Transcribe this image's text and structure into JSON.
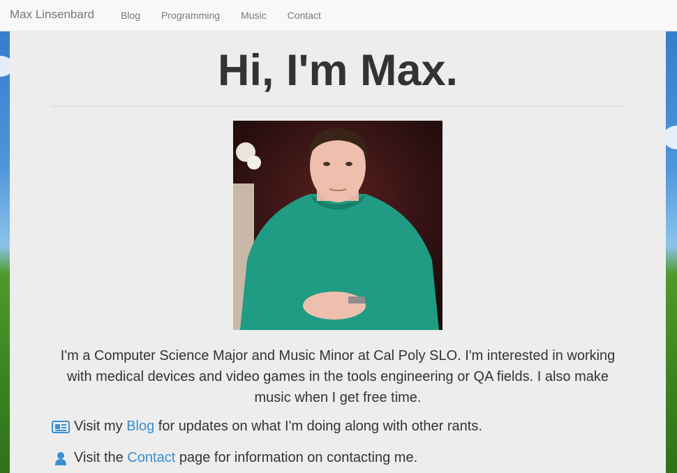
{
  "navbar": {
    "brand": "Max Linsenbard",
    "items": [
      {
        "label": "Blog"
      },
      {
        "label": "Programming"
      },
      {
        "label": "Music"
      },
      {
        "label": "Contact"
      }
    ]
  },
  "main": {
    "title": "Hi, I'm Max.",
    "intro": "I'm a Computer Science Major and Music Minor at Cal Poly SLO. I'm interested in working with medical devices and video games in the tools engineering or QA fields. I also make music when I get free time.",
    "blog_line": {
      "icon": "newspaper-icon",
      "prefix": "Visit my ",
      "link": "Blog",
      "suffix": " for updates on what I'm doing along with other rants."
    },
    "contact_line": {
      "icon": "user-icon",
      "prefix": "Visit the ",
      "link": "Contact",
      "suffix": " page for information on contacting me."
    }
  },
  "colors": {
    "link": "#3b8fd1",
    "text": "#333333",
    "container_bg": "#ededed",
    "navbar_bg": "#f8f8f8"
  }
}
